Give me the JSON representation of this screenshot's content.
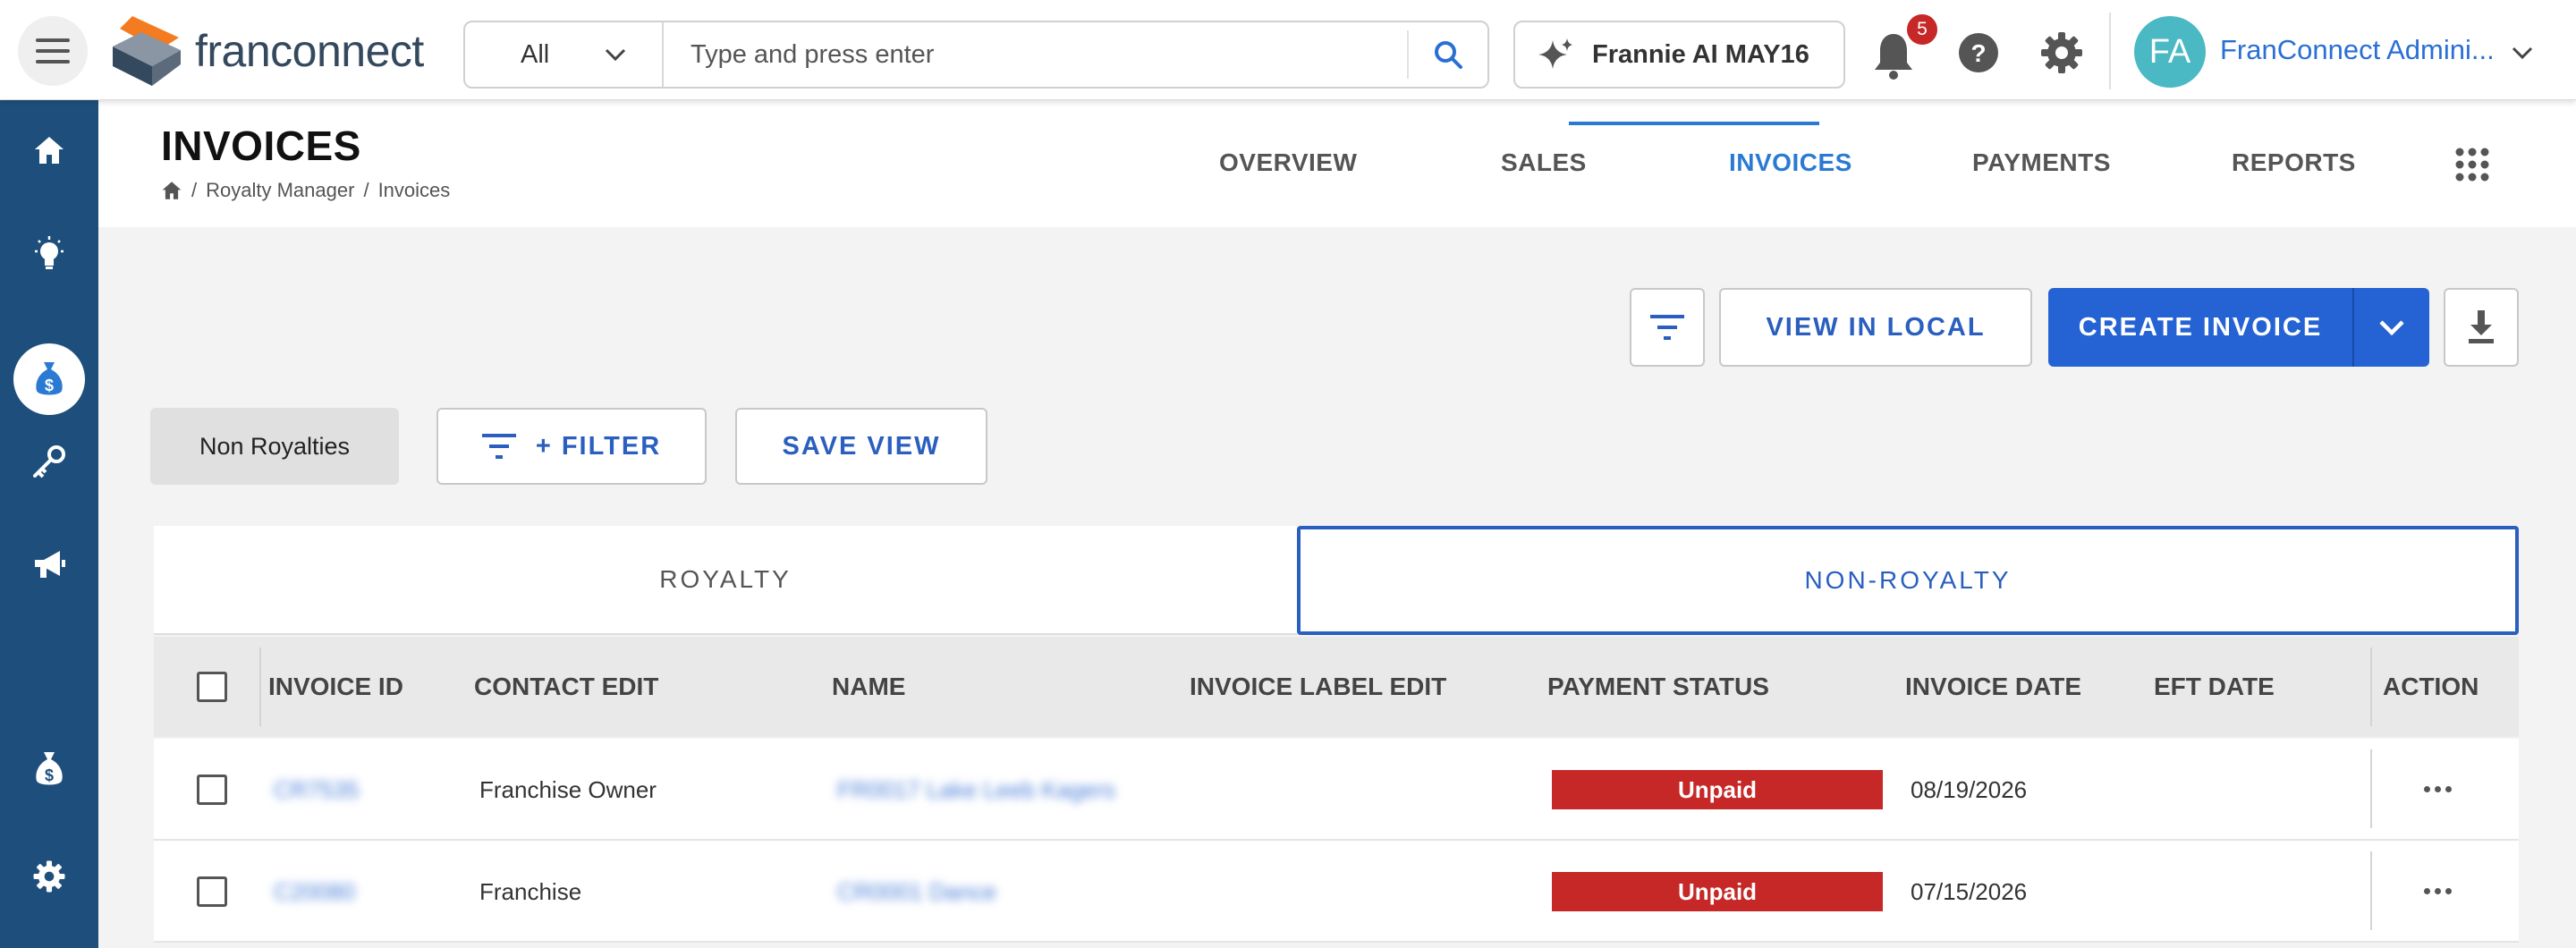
{
  "header": {
    "logo_text": "franconnect",
    "search_scope": "All",
    "search_placeholder": "Type and press enter",
    "ai_button_label": "Frannie AI MAY16",
    "notification_count": "5",
    "user_initials": "FA",
    "user_name": "FranConnect Admini..."
  },
  "sidebar": {
    "items": [
      "home-icon",
      "lightbulb-icon",
      "handshake-icon",
      "key-icon",
      "megaphone-icon",
      "money-bag-icon",
      "money-bag-icon",
      "gear-icon"
    ],
    "active_index": 5
  },
  "page": {
    "title": "INVOICES",
    "breadcrumb": [
      "Royalty Manager",
      "Invoices"
    ],
    "nav_tabs": [
      "OVERVIEW",
      "SALES",
      "INVOICES",
      "PAYMENTS",
      "REPORTS"
    ],
    "active_nav_tab": "INVOICES"
  },
  "actions": {
    "view_in_local": "VIEW IN LOCAL",
    "create_invoice": "CREATE INVOICE",
    "saved_view_chip": "Non Royalties",
    "filter_label": "+ FILTER",
    "save_view_label": "SAVE VIEW"
  },
  "tabs": {
    "royalty": "ROYALTY",
    "non_royalty": "NON-ROYALTY",
    "active": "NON-ROYALTY"
  },
  "table": {
    "columns": [
      "INVOICE ID",
      "CONTACT EDIT",
      "NAME",
      "INVOICE LABEL EDIT",
      "PAYMENT STATUS",
      "INVOICE DATE",
      "EFT DATE",
      "ACTION"
    ],
    "rows": [
      {
        "invoice_id": "CR7535",
        "contact": "Franchise Owner",
        "name": "FR0017 Lake Leeb Kagers",
        "label": "",
        "status": "Unpaid",
        "invoice_date": "08/19/2026",
        "eft_date": ""
      },
      {
        "invoice_id": "C20080",
        "contact": "Franchise",
        "name": "CR0001 Dance",
        "label": "",
        "status": "Unpaid",
        "invoice_date": "07/15/2026",
        "eft_date": ""
      }
    ]
  },
  "colors": {
    "sidebar_bg": "#1e4f7c",
    "primary": "#2563d4",
    "link": "#2a7ad4",
    "unpaid": "#c62828",
    "avatar": "#4ab9c4"
  }
}
